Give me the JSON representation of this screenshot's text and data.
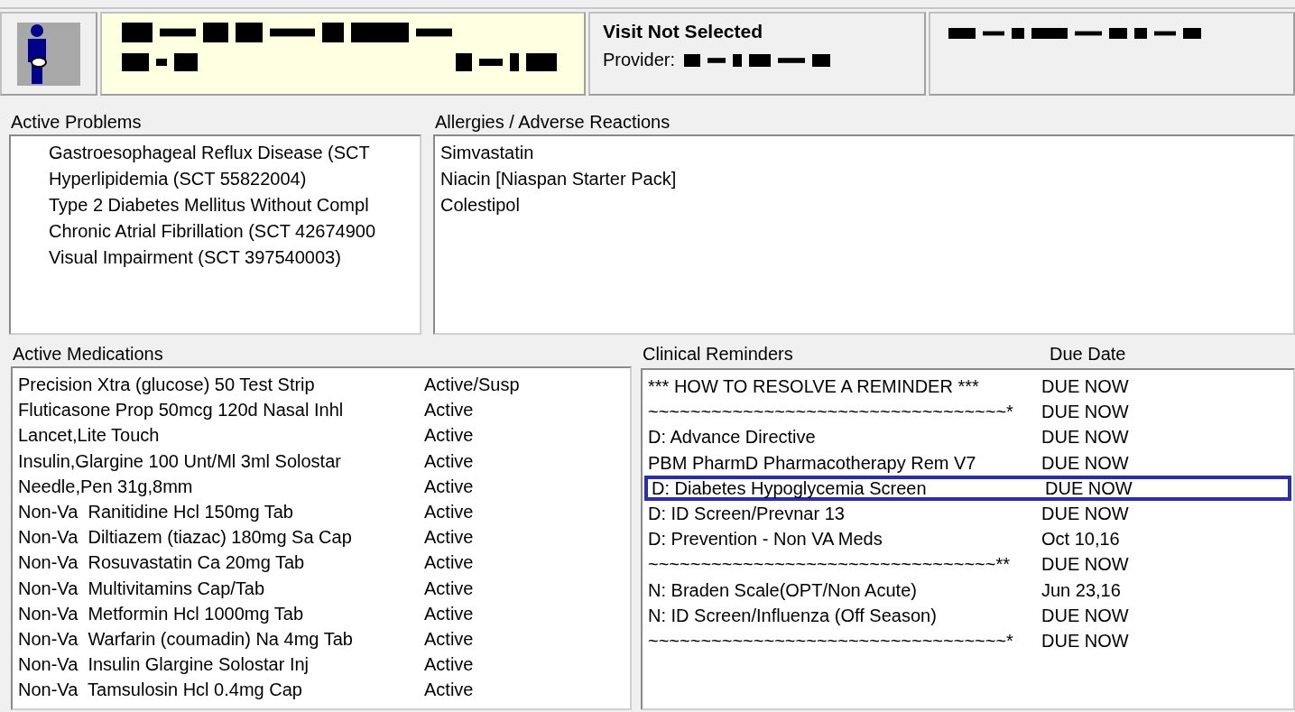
{
  "visit": {
    "title": "Visit Not Selected",
    "provider_label": "Provider:"
  },
  "problems": {
    "title": "Active Problems",
    "items": [
      "Gastroesophageal Reflux Disease (SCT",
      "Hyperlipidemia (SCT 55822004)",
      "Type 2 Diabetes Mellitus Without Compl",
      "Chronic Atrial Fibrillation (SCT 42674900",
      "Visual Impairment (SCT 397540003)"
    ]
  },
  "allergies": {
    "title": "Allergies / Adverse Reactions",
    "items": [
      "Simvastatin",
      "Niacin [Niaspan Starter Pack]",
      "Colestipol"
    ]
  },
  "medications": {
    "title": "Active Medications",
    "rows": [
      {
        "name": "Precision Xtra (glucose) 50 Test Strip",
        "status": "Active/Susp"
      },
      {
        "name": "Fluticasone Prop 50mcg 120d Nasal Inhl",
        "status": "Active"
      },
      {
        "name": "Lancet,Lite Touch",
        "status": "Active"
      },
      {
        "name": "Insulin,Glargine 100 Unt/Ml 3ml Solostar",
        "status": "Active"
      },
      {
        "name": "Needle,Pen 31g,8mm",
        "status": "Active"
      },
      {
        "name": "Non-Va  Ranitidine Hcl 150mg Tab",
        "status": "Active"
      },
      {
        "name": "Non-Va  Diltiazem (tiazac) 180mg Sa Cap",
        "status": "Active"
      },
      {
        "name": "Non-Va  Rosuvastatin Ca 20mg Tab",
        "status": "Active"
      },
      {
        "name": "Non-Va  Multivitamins Cap/Tab",
        "status": "Active"
      },
      {
        "name": "Non-Va  Metformin Hcl 1000mg Tab",
        "status": "Active"
      },
      {
        "name": "Non-Va  Warfarin (coumadin) Na 4mg Tab",
        "status": "Active"
      },
      {
        "name": "Non-Va  Insulin Glargine Solostar Inj",
        "status": "Active"
      },
      {
        "name": "Non-Va  Tamsulosin Hcl 0.4mg Cap",
        "status": "Active"
      }
    ]
  },
  "reminders": {
    "title": "Clinical Reminders",
    "due_header": "Due Date",
    "rows": [
      {
        "name": "*** HOW TO RESOLVE A REMINDER ***",
        "due": "DUE NOW",
        "highlighted": false
      },
      {
        "name": "~~~~~~~~~~~~~~~~~~~~~~~~~~~~~~~~~~*",
        "due": "DUE NOW",
        "highlighted": false
      },
      {
        "name": "D: Advance Directive",
        "due": "DUE NOW",
        "highlighted": false
      },
      {
        "name": "PBM PharmD Pharmacotherapy Rem V7",
        "due": "DUE NOW",
        "highlighted": false
      },
      {
        "name": "D: Diabetes Hypoglycemia Screen",
        "due": "DUE NOW",
        "highlighted": true
      },
      {
        "name": "D: ID Screen/Prevnar 13",
        "due": "DUE NOW",
        "highlighted": false
      },
      {
        "name": "D: Prevention - Non VA Meds",
        "due": "Oct 10,16",
        "highlighted": false
      },
      {
        "name": "~~~~~~~~~~~~~~~~~~~~~~~~~~~~~~~~~**",
        "due": "DUE NOW",
        "highlighted": false
      },
      {
        "name": "N: Braden Scale(OPT/Non Acute)",
        "due": "Jun 23,16",
        "highlighted": false
      },
      {
        "name": "N: ID Screen/Influenza (Off Season)",
        "due": "DUE NOW",
        "highlighted": false
      },
      {
        "name": "~~~~~~~~~~~~~~~~~~~~~~~~~~~~~~~~~~*",
        "due": "DUE NOW",
        "highlighted": false
      }
    ]
  }
}
